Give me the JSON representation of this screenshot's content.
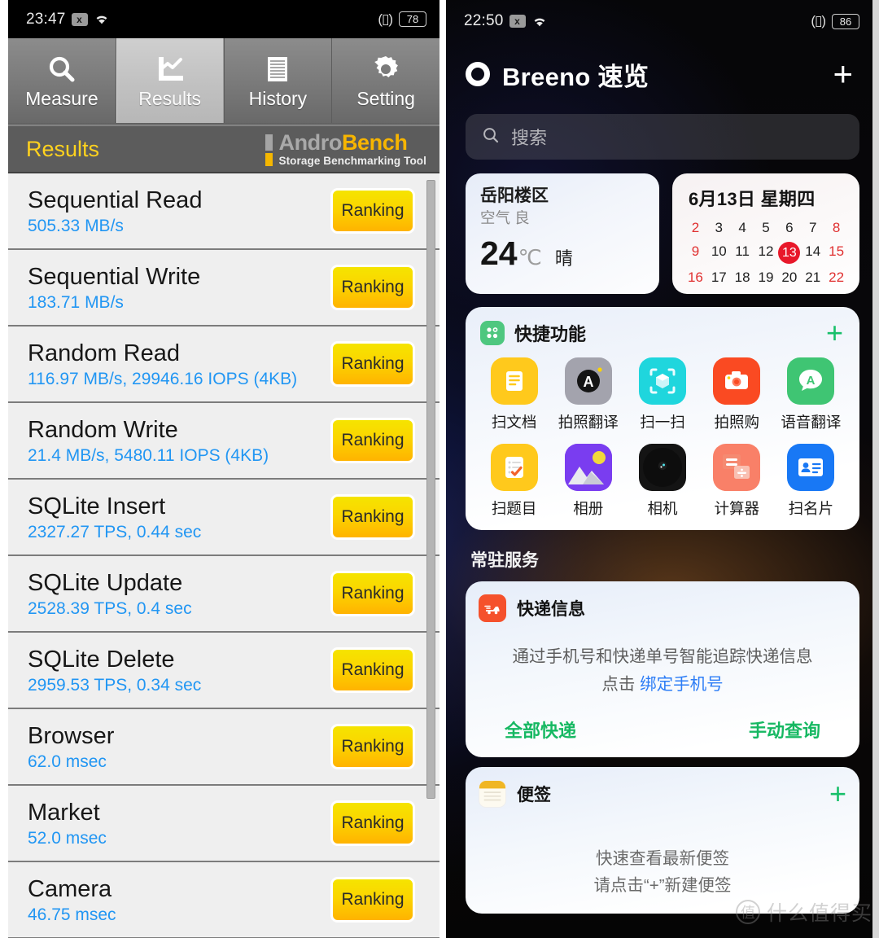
{
  "left_phone": {
    "status_bar": {
      "time": "23:47",
      "x_badge": "x",
      "wifi_icon": "wifi-icon",
      "vibrate_icon": "vibrate-icon",
      "battery": "78"
    },
    "tabs": [
      {
        "label": "Measure",
        "icon": "magnifier-icon",
        "active": false
      },
      {
        "label": "Results",
        "icon": "chart-icon",
        "active": true
      },
      {
        "label": "History",
        "icon": "document-icon",
        "active": false
      },
      {
        "label": "Setting",
        "icon": "gear-icon",
        "active": false
      }
    ],
    "header": {
      "title": "Results",
      "logo_andro": "Andro",
      "logo_bench": "Bench",
      "logo_tagline": "Storage Benchmarking Tool",
      "title_color": "#ffd21e",
      "logo_accent": "#f7b500"
    },
    "results": [
      {
        "name": "Sequential Read",
        "value": "505.33 MB/s",
        "button": "Ranking"
      },
      {
        "name": "Sequential Write",
        "value": "183.71 MB/s",
        "button": "Ranking"
      },
      {
        "name": "Random Read",
        "value": "116.97 MB/s, 29946.16 IOPS (4KB)",
        "button": "Ranking"
      },
      {
        "name": "Random Write",
        "value": "21.4 MB/s, 5480.11 IOPS (4KB)",
        "button": "Ranking"
      },
      {
        "name": "SQLite Insert",
        "value": "2327.27 TPS, 0.44 sec",
        "button": "Ranking"
      },
      {
        "name": "SQLite Update",
        "value": "2528.39 TPS, 0.4 sec",
        "button": "Ranking"
      },
      {
        "name": "SQLite Delete",
        "value": "2959.53 TPS, 0.34 sec",
        "button": "Ranking"
      },
      {
        "name": "Browser",
        "value": "62.0 msec",
        "button": "Ranking"
      },
      {
        "name": "Market",
        "value": "52.0 msec",
        "button": "Ranking"
      },
      {
        "name": "Camera",
        "value": "46.75 msec",
        "button": "Ranking"
      }
    ]
  },
  "right_phone": {
    "status_bar": {
      "time": "22:50",
      "x_badge": "x",
      "wifi_icon": "wifi-icon",
      "vibrate_icon": "vibrate-icon",
      "battery": "86"
    },
    "header": {
      "title": "Breeno 速览",
      "logo_icon": "breeno-ring-icon",
      "add_label": "+"
    },
    "search": {
      "placeholder": "搜索",
      "icon": "search-icon"
    },
    "weather": {
      "city": "岳阳楼区",
      "air": "空气 良",
      "temp": "24",
      "degree": "℃",
      "condition": "晴"
    },
    "calendar": {
      "date_title": "6月13日 星期四",
      "days": [
        {
          "n": "2",
          "weekend": true,
          "today": false
        },
        {
          "n": "3",
          "weekend": false,
          "today": false
        },
        {
          "n": "4",
          "weekend": false,
          "today": false
        },
        {
          "n": "5",
          "weekend": false,
          "today": false
        },
        {
          "n": "6",
          "weekend": false,
          "today": false
        },
        {
          "n": "7",
          "weekend": false,
          "today": false
        },
        {
          "n": "8",
          "weekend": true,
          "today": false
        },
        {
          "n": "9",
          "weekend": true,
          "today": false
        },
        {
          "n": "10",
          "weekend": false,
          "today": false
        },
        {
          "n": "11",
          "weekend": false,
          "today": false
        },
        {
          "n": "12",
          "weekend": false,
          "today": false
        },
        {
          "n": "13",
          "weekend": false,
          "today": true
        },
        {
          "n": "14",
          "weekend": false,
          "today": false
        },
        {
          "n": "15",
          "weekend": true,
          "today": false
        },
        {
          "n": "16",
          "weekend": true,
          "today": false
        },
        {
          "n": "17",
          "weekend": false,
          "today": false
        },
        {
          "n": "18",
          "weekend": false,
          "today": false
        },
        {
          "n": "19",
          "weekend": false,
          "today": false
        },
        {
          "n": "20",
          "weekend": false,
          "today": false
        },
        {
          "n": "21",
          "weekend": false,
          "today": false
        },
        {
          "n": "22",
          "weekend": true,
          "today": false
        }
      ],
      "today_color": "#e8182a",
      "weekend_color": "#e03030"
    },
    "quick_panel": {
      "title": "快捷功能",
      "icon": "apps-grid-icon",
      "add_label": "+",
      "items": [
        {
          "label": "扫文档",
          "icon": "scan-document-icon",
          "color": "#ffc91c"
        },
        {
          "label": "拍照翻译",
          "icon": "photo-translate-icon",
          "color": "#a3a3ad"
        },
        {
          "label": "扫一扫",
          "icon": "scan-qr-icon",
          "color": "#1fd6dd"
        },
        {
          "label": "拍照购",
          "icon": "photo-shop-icon",
          "color": "#fa4a22"
        },
        {
          "label": "语音翻译",
          "icon": "voice-translate-icon",
          "color": "#3fc573"
        },
        {
          "label": "扫题目",
          "icon": "scan-question-icon",
          "color": "#ffc91c"
        },
        {
          "label": "相册",
          "icon": "gallery-icon",
          "color": "#7a3df0"
        },
        {
          "label": "相机",
          "icon": "camera-lens-icon",
          "color": "#141414"
        },
        {
          "label": "计算器",
          "icon": "calculator-icon",
          "color": "#f98068"
        },
        {
          "label": "扫名片",
          "icon": "scan-card-icon",
          "color": "#1878f5"
        }
      ]
    },
    "resident_services_title": "常驻服务",
    "express_card": {
      "name": "快递信息",
      "icon": "delivery-truck-icon",
      "icon_color": "#f5512c",
      "desc_line1": "通过手机号和快递单号智能追踪快递信息",
      "desc_prefix": "点击 ",
      "desc_link": "绑定手机号",
      "action_left": "全部快递",
      "action_right": "手动查询",
      "action_color": "#16b862"
    },
    "notes_card": {
      "name": "便签",
      "icon": "notes-icon",
      "icon_color": "#f0b624",
      "add_label": "+",
      "line1": "快速查看最新便签",
      "line2": "请点击“+”新建便签"
    },
    "watermark": {
      "mark": "值",
      "text": "什么值得买"
    }
  }
}
